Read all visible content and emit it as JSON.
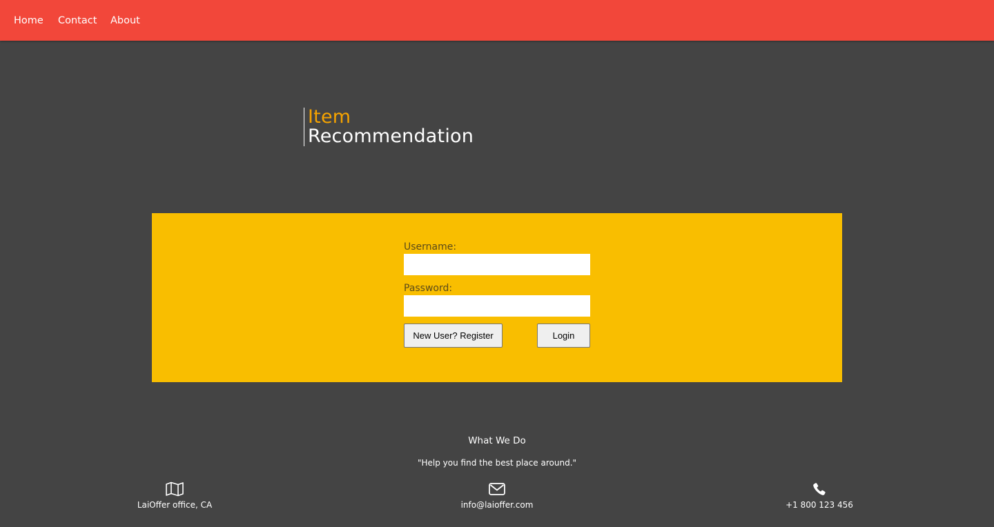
{
  "nav": {
    "home": "Home",
    "contact": "Contact",
    "about": "About"
  },
  "brand": {
    "line1": "Item",
    "line2": "Recommendation"
  },
  "login": {
    "username_label": "Username:",
    "username_value": "",
    "password_label": "Password:",
    "password_value": "",
    "register_button": "New User? Register",
    "login_button": "Login"
  },
  "footer": {
    "title": "What We Do",
    "quote": "\"Help you find the best place around.\"",
    "office": {
      "icon": "map-icon",
      "text": "LaiOffer office, CA"
    },
    "email": {
      "icon": "envelope-icon",
      "text": "info@laioffer.com"
    },
    "phone": {
      "icon": "phone-icon",
      "text": "+1 800 123 456"
    }
  },
  "colors": {
    "nav_bg": "#f2473a",
    "page_bg": "#444444",
    "panel_bg": "#f9be00",
    "brand_accent": "#f5a300"
  }
}
